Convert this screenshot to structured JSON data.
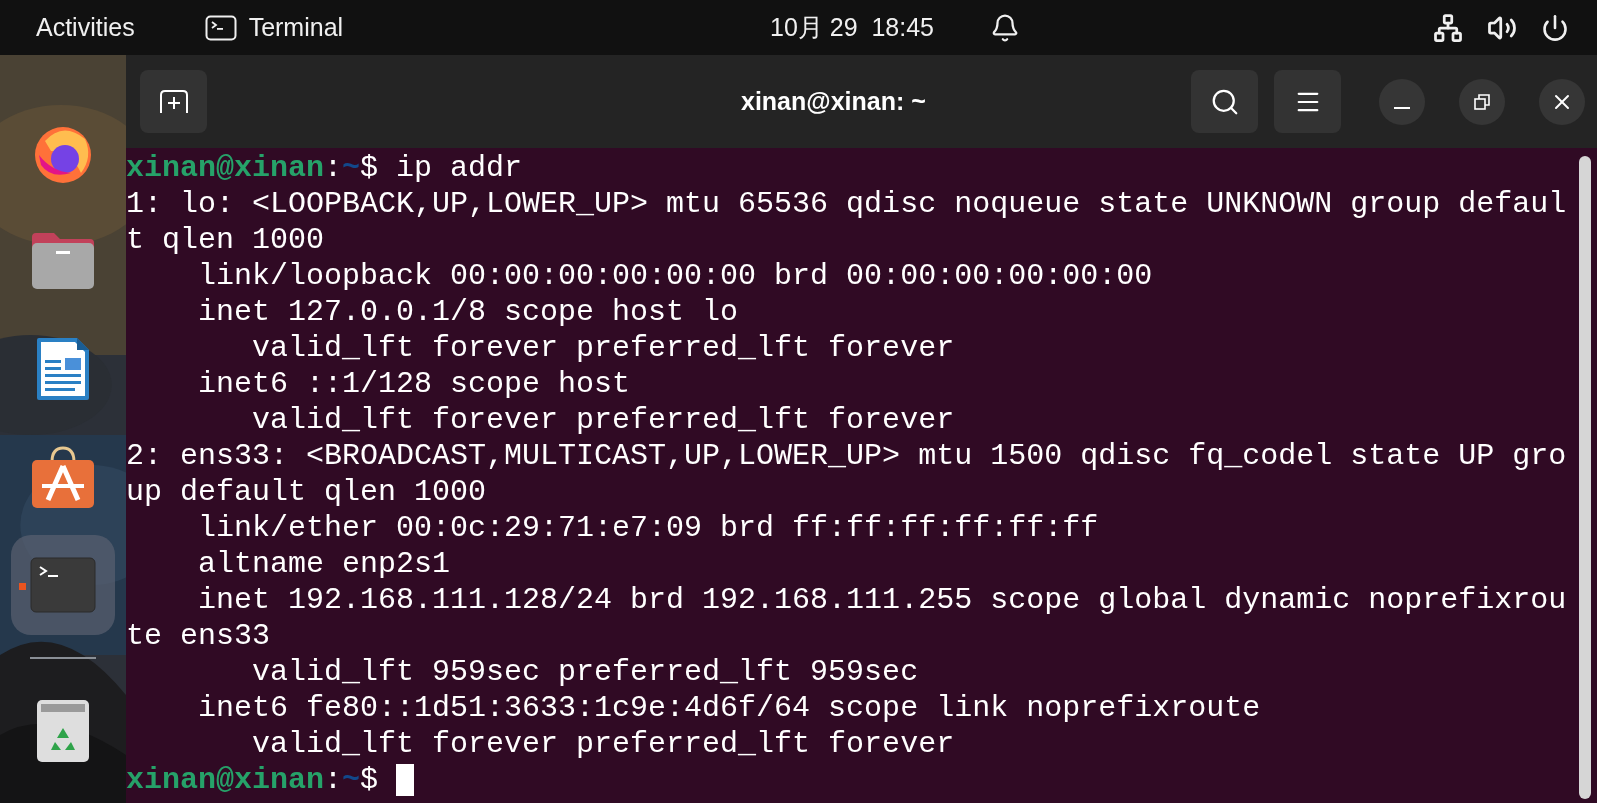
{
  "top_bar": {
    "activities": "Activities",
    "app": "Terminal",
    "clock": "10月 29  18:45"
  },
  "dock": {
    "items": [
      {
        "kind": "firefox",
        "selected": false,
        "running": false
      },
      {
        "kind": "files",
        "selected": false,
        "running": false
      },
      {
        "kind": "writer",
        "selected": false,
        "running": false
      },
      {
        "kind": "store",
        "selected": false,
        "running": false
      },
      {
        "kind": "terminal",
        "selected": true,
        "running": true
      },
      {
        "kind": "separator"
      },
      {
        "kind": "trash",
        "selected": false,
        "running": false
      }
    ]
  },
  "window": {
    "title": "xinan@xinan: ~"
  },
  "terminal": {
    "lines": [
      {
        "kind": "prompt",
        "user": "xinan@xinan",
        "separator": ":",
        "path": "~",
        "symbol": "$ ",
        "command": "ip addr",
        "cursor": false
      },
      {
        "kind": "output",
        "text": "1: lo: <LOOPBACK,UP,LOWER_UP> mtu 65536 qdisc noqueue state UNKNOWN group defaul"
      },
      {
        "kind": "output",
        "text": "t qlen 1000"
      },
      {
        "kind": "output",
        "text": "    link/loopback 00:00:00:00:00:00 brd 00:00:00:00:00:00"
      },
      {
        "kind": "output",
        "text": "    inet 127.0.0.1/8 scope host lo"
      },
      {
        "kind": "output",
        "text": "       valid_lft forever preferred_lft forever"
      },
      {
        "kind": "output",
        "text": "    inet6 ::1/128 scope host"
      },
      {
        "kind": "output",
        "text": "       valid_lft forever preferred_lft forever"
      },
      {
        "kind": "output",
        "text": "2: ens33: <BROADCAST,MULTICAST,UP,LOWER_UP> mtu 1500 qdisc fq_codel state UP gro"
      },
      {
        "kind": "output",
        "text": "up default qlen 1000"
      },
      {
        "kind": "output",
        "text": "    link/ether 00:0c:29:71:e7:09 brd ff:ff:ff:ff:ff:ff"
      },
      {
        "kind": "output",
        "text": "    altname enp2s1"
      },
      {
        "kind": "output",
        "text": "    inet 192.168.111.128/24 brd 192.168.111.255 scope global dynamic noprefixrou"
      },
      {
        "kind": "output",
        "text": "te ens33"
      },
      {
        "kind": "output",
        "text": "       valid_lft 959sec preferred_lft 959sec"
      },
      {
        "kind": "output",
        "text": "    inet6 fe80::1d51:3633:1c9e:4d6f/64 scope link noprefixroute"
      },
      {
        "kind": "output",
        "text": "       valid_lft forever preferred_lft forever"
      },
      {
        "kind": "prompt",
        "user": "xinan@xinan",
        "separator": ":",
        "path": "~",
        "symbol": "$ ",
        "cursor": true
      }
    ]
  }
}
